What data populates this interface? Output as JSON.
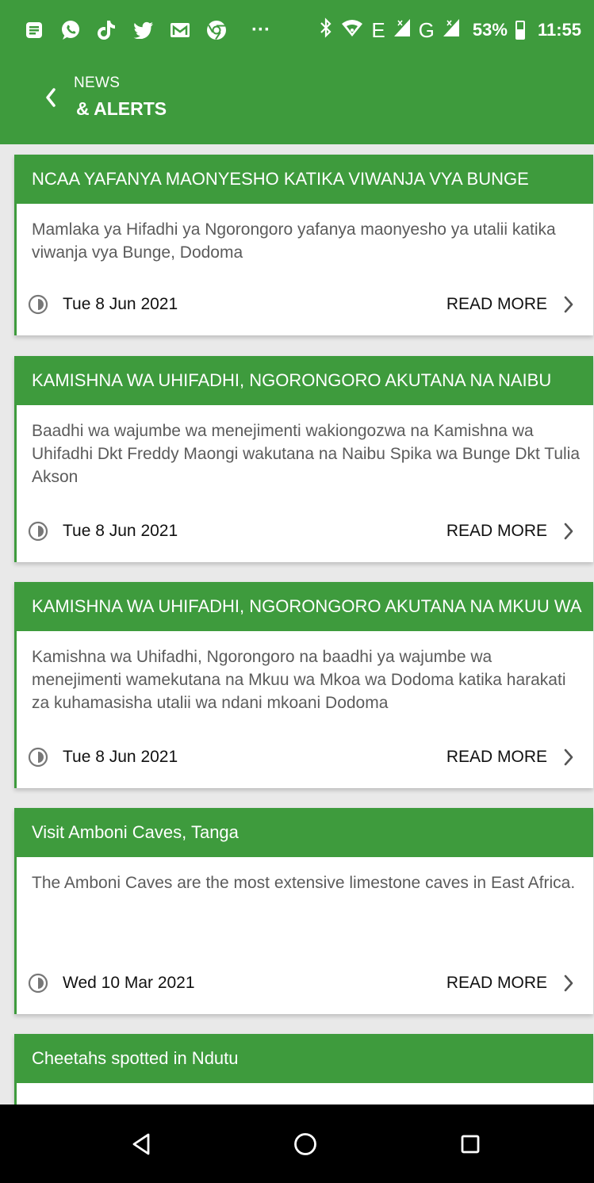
{
  "status_bar": {
    "icons": [
      "notes-icon",
      "whatsapp-icon",
      "tiktok-icon",
      "twitter-icon",
      "gmail-icon",
      "chrome-icon",
      "more-notifications-icon"
    ],
    "more": "···",
    "network_1": "E",
    "network_2": "G",
    "battery": "53%",
    "time": "11:55"
  },
  "header": {
    "title_small": "NEWS",
    "title_big": "& ALERTS"
  },
  "news": [
    {
      "title": "NCAA YAFANYA MAONYESHO KATIKA VIWANJA VYA BUNGE",
      "summary": "Mamlaka ya Hifadhi ya Ngorongoro yafanya maonyesho ya utalii katika viwanja vya Bunge, Dodoma",
      "date": "Tue 8 Jun 2021",
      "action": "READ MORE"
    },
    {
      "title": "KAMISHNA WA UHIFADHI, NGORONGORO AKUTANA NA NAIBU",
      "summary": "Baadhi wa wajumbe wa menejimenti wakiongozwa na Kamishna wa Uhifadhi Dkt Freddy Maongi wakutana na Naibu Spika wa Bunge Dkt Tulia Akson",
      "date": "Tue 8 Jun 2021",
      "action": "READ MORE"
    },
    {
      "title": "KAMISHNA WA UHIFADHI, NGORONGORO AKUTANA NA MKUU WA",
      "summary": "Kamishna wa Uhifadhi, Ngorongoro na baadhi ya wajumbe wa menejimenti wamekutana na Mkuu wa Mkoa wa Dodoma katika harakati za kuhamasisha utalii wa ndani mkoani Dodoma",
      "date": "Tue 8 Jun 2021",
      "action": "READ MORE"
    },
    {
      "title": "Visit Amboni Caves, Tanga",
      "summary": "The Amboni Caves are the most extensive limestone caves in East Africa.",
      "date": "Wed 10 Mar 2021",
      "action": "READ MORE"
    },
    {
      "title": "Cheetahs spotted in Ndutu",
      "summary": "",
      "date": "",
      "action": ""
    }
  ],
  "nav_bar": {
    "back": "back-triangle-icon",
    "home": "home-circle-icon",
    "recents": "recents-square-icon"
  },
  "colors": {
    "primary": "#3e9b3d",
    "background": "#e9e9e9",
    "nav": "#000000"
  }
}
